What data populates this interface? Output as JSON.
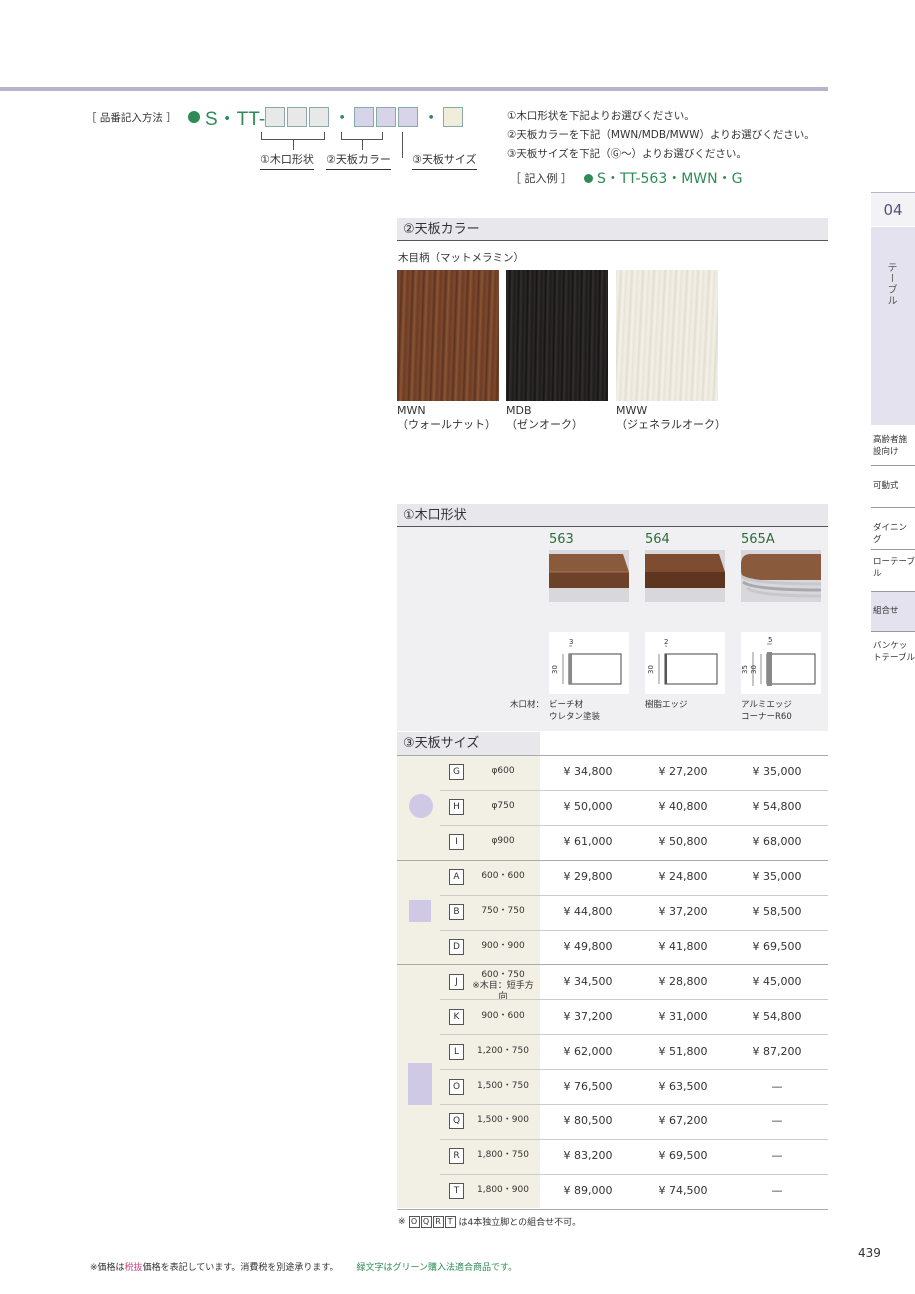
{
  "header": {
    "howto_label": "［ 品番記入方法 ］",
    "pn_prefix": "S・TT-",
    "sub1": "①木口形状",
    "sub2": "②天板カラー",
    "sub3": "③天板サイズ",
    "instructions": [
      "①木口形状を下記よりお選びください。",
      "②天板カラーを下記（MWN/MDB/MWW）よりお選びください。",
      "③天板サイズを下記（Ⓖ〜）よりお選びください。"
    ],
    "example_label": "［ 記入例 ］",
    "example_value": "S・TT-563・MWN・G"
  },
  "side_nav": {
    "number": "04",
    "main_label": "テーブル",
    "items": [
      "高齢者施設向け",
      "可動式",
      "ダイニング",
      "ローテーブル",
      "組合せ",
      "バンケットテーブル"
    ],
    "active": "組合せ"
  },
  "color_section": {
    "title": "②天板カラー",
    "material": "木目柄（マットメラミン）",
    "swatches": [
      {
        "code": "MWN",
        "name": "（ウォールナット）",
        "color": "#6e3c25"
      },
      {
        "code": "MDB",
        "name": "（ゼンオーク）",
        "color": "#1e1c1c"
      },
      {
        "code": "MWW",
        "name": "（ジェネラルオーク）",
        "color": "#ebe7dc"
      }
    ]
  },
  "edge_section": {
    "title": "①木口形状",
    "material_label": "木口材：",
    "items": [
      {
        "code": "563",
        "dim_top": "3",
        "dim_side": "30",
        "note1": "ビーチ材",
        "note2": "ウレタン塗装"
      },
      {
        "code": "564",
        "dim_top": "2",
        "dim_side": "30",
        "note1": "樹脂エッジ",
        "note2": ""
      },
      {
        "code": "565A",
        "dim_top": "5",
        "dim_side": "30",
        "dim_side2": "35",
        "note1": "アルミエッジ",
        "note2": "コーナーR60"
      }
    ]
  },
  "size_section": {
    "title": "③天板サイズ",
    "rows": [
      {
        "code": "G",
        "dim": "φ600",
        "note": "",
        "p1": "¥ 34,800",
        "p2": "¥ 27,200",
        "p3": "¥ 35,000"
      },
      {
        "code": "H",
        "dim": "φ750",
        "note": "",
        "p1": "¥ 50,000",
        "p2": "¥ 40,800",
        "p3": "¥ 54,800"
      },
      {
        "code": "I",
        "dim": "φ900",
        "note": "",
        "p1": "¥ 61,000",
        "p2": "¥ 50,800",
        "p3": "¥ 68,000"
      },
      {
        "code": "A",
        "dim": "600・600",
        "note": "",
        "p1": "¥ 29,800",
        "p2": "¥ 24,800",
        "p3": "¥ 35,000"
      },
      {
        "code": "B",
        "dim": "750・750",
        "note": "",
        "p1": "¥ 44,800",
        "p2": "¥ 37,200",
        "p3": "¥ 58,500"
      },
      {
        "code": "D",
        "dim": "900・900",
        "note": "",
        "p1": "¥ 49,800",
        "p2": "¥ 41,800",
        "p3": "¥ 69,500"
      },
      {
        "code": "J",
        "dim": "600・750",
        "note": "※木目：短手方向",
        "p1": "¥ 34,500",
        "p2": "¥ 28,800",
        "p3": "¥ 45,000"
      },
      {
        "code": "K",
        "dim": "900・600",
        "note": "",
        "p1": "¥ 37,200",
        "p2": "¥ 31,000",
        "p3": "¥ 54,800"
      },
      {
        "code": "L",
        "dim": "1,200・750",
        "note": "",
        "p1": "¥ 62,000",
        "p2": "¥ 51,800",
        "p3": "¥ 87,200"
      },
      {
        "code": "O",
        "dim": "1,500・750",
        "note": "",
        "p1": "¥ 76,500",
        "p2": "¥ 63,500",
        "p3": "—"
      },
      {
        "code": "Q",
        "dim": "1,500・900",
        "note": "",
        "p1": "¥ 80,500",
        "p2": "¥ 67,200",
        "p3": "—"
      },
      {
        "code": "R",
        "dim": "1,800・750",
        "note": "",
        "p1": "¥ 83,200",
        "p2": "¥ 69,500",
        "p3": "—"
      },
      {
        "code": "T",
        "dim": "1,800・900",
        "note": "",
        "p1": "¥ 89,000",
        "p2": "¥ 74,500",
        "p3": "—"
      }
    ],
    "footnote_prefix": "※",
    "footnote_codes": [
      "O",
      "Q",
      "R",
      "T"
    ],
    "footnote_text": "は4本独立脚との組合せ不可。"
  },
  "footer": {
    "note_a": "※価格は",
    "note_pink": "税抜",
    "note_b": "価格を表記しています。消費税を別途承ります。",
    "note_green": "緑文字はグリーン購入法適合商品です。",
    "page": "439"
  }
}
